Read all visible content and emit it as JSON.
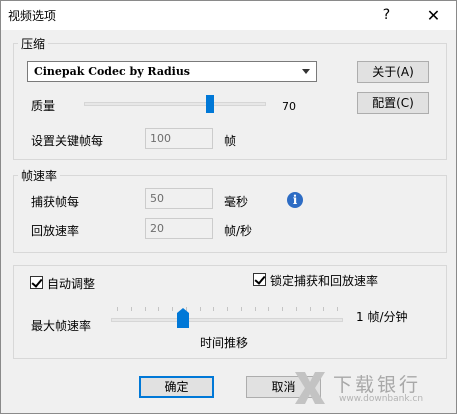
{
  "window": {
    "title": "视频选项",
    "help_glyph": "?",
    "close_glyph": "✕"
  },
  "compression": {
    "group_label": "压缩",
    "codec_value": "Cinepak Codec by Radius",
    "about_button": "关于(A)",
    "config_button": "配置(C)",
    "quality_label": "质量",
    "quality_value": "70",
    "quality_level": 0.7,
    "keyframe_label": "设置关键帧每",
    "keyframe_value": "100",
    "keyframe_unit": "帧"
  },
  "framerate": {
    "group_label": "帧速率",
    "capture_label": "捕获帧每",
    "capture_value": "50",
    "capture_unit": "毫秒",
    "playback_label": "回放速率",
    "playback_value": "20",
    "playback_unit": "帧/秒",
    "info_glyph": "i"
  },
  "auto": {
    "auto_adjust_label": "自动调整",
    "auto_adjust_checked": true,
    "lock_label": "锁定捕获和回放速率",
    "lock_checked": true,
    "max_rate_label": "最大帧速率",
    "max_rate_value": "1 帧/分钟",
    "slider_caption": "时间推移",
    "max_rate_level": 0.3
  },
  "footer": {
    "ok_button": "确定",
    "cancel_button": "取消"
  },
  "watermark": {
    "title": "下载银行",
    "url": "www.downbank.cn"
  },
  "colors": {
    "accent": "#0078d7",
    "info": "#2d6cc4"
  }
}
